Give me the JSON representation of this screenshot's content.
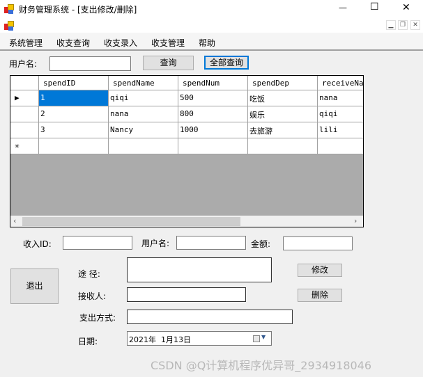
{
  "window": {
    "title": "财务管理系统 - [支出修改/删除]",
    "controls": {
      "minimize": "—",
      "maximize": "☐",
      "close": "✕"
    }
  },
  "mdi_controls": {
    "minimize": "▁",
    "restore": "❐",
    "close": "✕"
  },
  "menu": [
    "系统管理",
    "收支查询",
    "收支录入",
    "收支管理",
    "帮助"
  ],
  "search": {
    "label": "用户名:",
    "value": "",
    "query_button": "查询",
    "query_all_button": "全部查询"
  },
  "grid": {
    "columns": [
      "spendID",
      "spendName",
      "spendNum",
      "spendDep",
      "receiveNam"
    ],
    "rows": [
      [
        "1",
        "qiqi",
        "500",
        "吃饭",
        "nana"
      ],
      [
        "2",
        "nana",
        "800",
        "娱乐",
        "qiqi"
      ],
      [
        "3",
        "Nancy",
        "1000",
        "去旅游",
        "lili"
      ]
    ],
    "current_row_marker": "▶",
    "new_row_marker": "✳",
    "selected_row": 0
  },
  "form": {
    "income_id_label": "收入ID:",
    "income_id": "",
    "user_label": "用户名:",
    "user": "",
    "amount_label": "金额:",
    "amount": "",
    "route_label": "途 径:",
    "route": "",
    "receiver_label": "接收人:",
    "receiver": "",
    "pay_method_label": "支出方式:",
    "pay_method": "",
    "date_label": "日期:",
    "date": "2021年  1月13日",
    "exit_button": "退出",
    "modify_button": "修改",
    "delete_button": "删除"
  },
  "watermark": "CSDN @Q计算机程序优异哥_2934918046"
}
